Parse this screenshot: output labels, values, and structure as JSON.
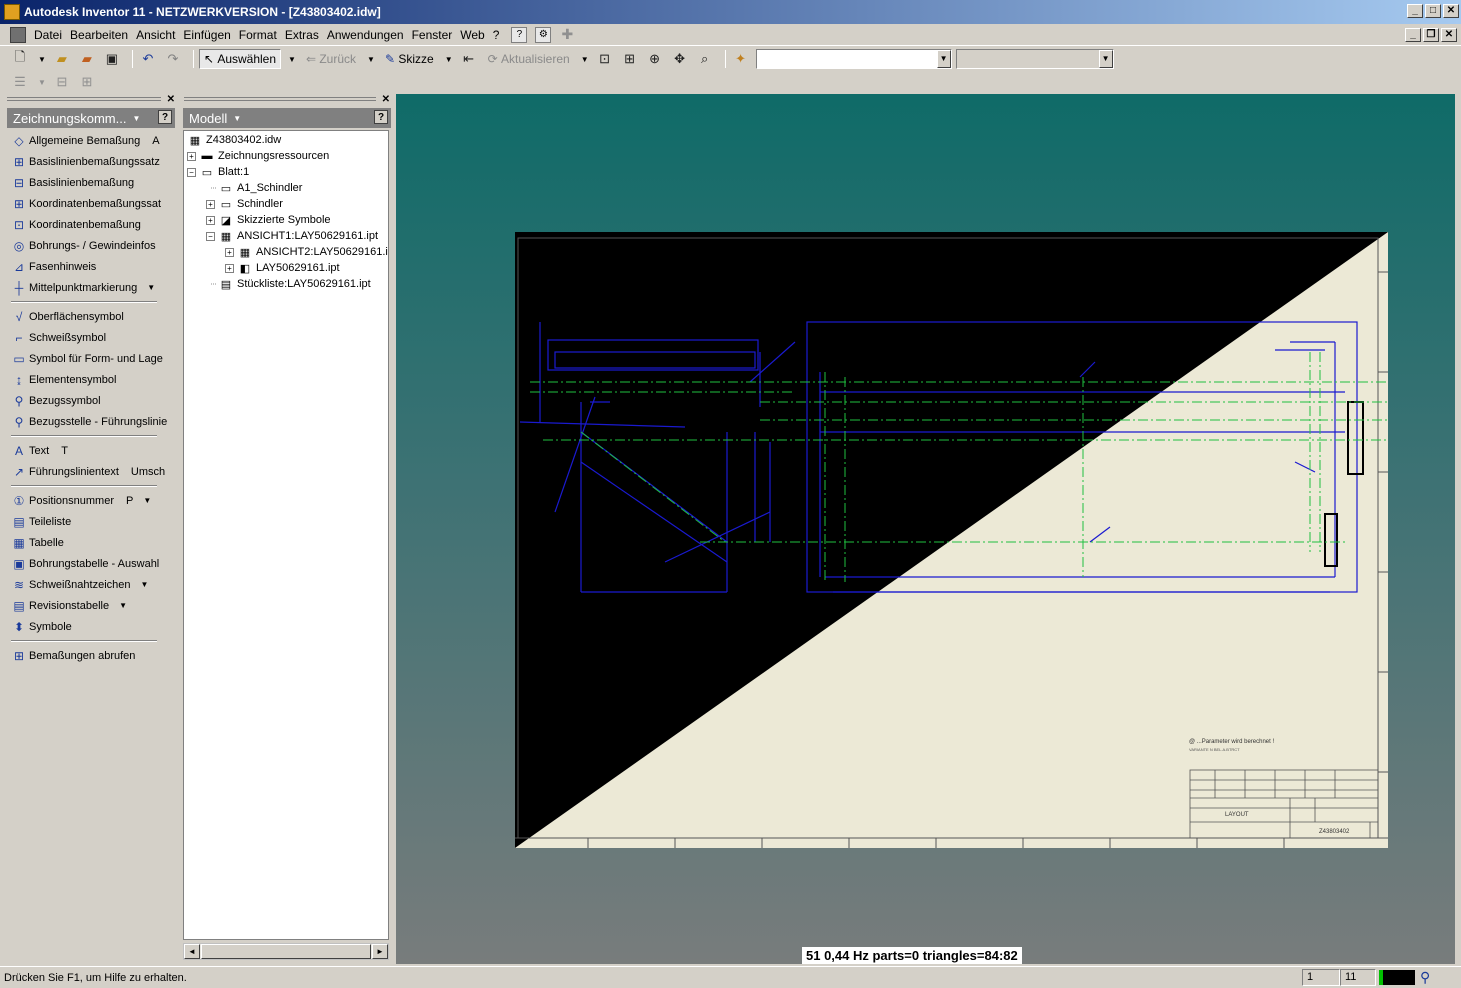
{
  "window": {
    "title": "Autodesk Inventor 11 - NETZWERKVERSION - [Z43803402.idw]",
    "buttons": [
      "_",
      "□",
      "✕"
    ]
  },
  "menubar": {
    "items": [
      "Datei",
      "Bearbeiten",
      "Ansicht",
      "Einfügen",
      "Format",
      "Extras",
      "Anwendungen",
      "Fenster",
      "Web",
      "?"
    ]
  },
  "toolbar": {
    "select_label": "Auswählen",
    "back_label": "Zurück",
    "sketch_label": "Skizze",
    "update_label": "Aktualisieren",
    "combo1_value": "",
    "combo2_value": ""
  },
  "commands_panel": {
    "title": "Zeichnungskomm...",
    "help": "?",
    "groups": [
      [
        {
          "icon": "general-dimension-icon",
          "glyph": "◇",
          "label": "Allgemeine Bemaßung",
          "shortcut": "A",
          "dropdown": ""
        },
        {
          "icon": "baseline-set-icon",
          "glyph": "⊞",
          "label": "Basislinienbemaßungssatz",
          "shortcut": "",
          "dropdown": ""
        },
        {
          "icon": "baseline-dimension-icon",
          "glyph": "⊟",
          "label": "Basislinienbemaßung",
          "shortcut": "",
          "dropdown": ""
        },
        {
          "icon": "ordinate-set-icon",
          "glyph": "⊞",
          "label": "Koordinatenbemaßungssat",
          "shortcut": "",
          "dropdown": ""
        },
        {
          "icon": "ordinate-dimension-icon",
          "glyph": "⊡",
          "label": "Koordinatenbemaßung",
          "shortcut": "",
          "dropdown": ""
        },
        {
          "icon": "hole-thread-note-icon",
          "glyph": "◎",
          "label": "Bohrungs- / Gewindeinfos",
          "shortcut": "",
          "dropdown": ""
        },
        {
          "icon": "chamfer-note-icon",
          "glyph": "⊿",
          "label": "Fasenhinweis",
          "shortcut": "",
          "dropdown": ""
        },
        {
          "icon": "center-mark-icon",
          "glyph": "┼",
          "label": "Mittelpunktmarkierung",
          "shortcut": "",
          "dropdown": "▼"
        }
      ],
      [
        {
          "icon": "surface-texture-icon",
          "glyph": "√",
          "label": "Oberflächensymbol",
          "shortcut": "",
          "dropdown": ""
        },
        {
          "icon": "weld-symbol-icon",
          "glyph": "⌐",
          "label": "Schweißsymbol",
          "shortcut": "",
          "dropdown": ""
        },
        {
          "icon": "feature-control-frame-icon",
          "glyph": "▭",
          "label": "Symbol für Form- und Lage",
          "shortcut": "",
          "dropdown": ""
        },
        {
          "icon": "feature-identifier-icon",
          "glyph": "↨",
          "label": "Elementensymbol",
          "shortcut": "",
          "dropdown": ""
        },
        {
          "icon": "datum-identifier-icon",
          "glyph": "⚲",
          "label": "Bezugssymbol",
          "shortcut": "",
          "dropdown": ""
        },
        {
          "icon": "datum-target-leader-icon",
          "glyph": "⚲",
          "label": "Bezugsstelle - Führungslinie",
          "shortcut": "",
          "dropdown": ""
        }
      ],
      [
        {
          "icon": "text-icon",
          "glyph": "A",
          "label": "Text",
          "shortcut": "T",
          "dropdown": ""
        },
        {
          "icon": "leader-text-icon",
          "glyph": "↗",
          "label": "Führungslinientext",
          "shortcut": "Umsch",
          "dropdown": ""
        }
      ],
      [
        {
          "icon": "balloon-icon",
          "glyph": "①",
          "label": "Positionsnummer",
          "shortcut": "P",
          "dropdown": "▼"
        },
        {
          "icon": "parts-list-icon",
          "glyph": "▤",
          "label": "Teileliste",
          "shortcut": "",
          "dropdown": ""
        },
        {
          "icon": "table-icon",
          "glyph": "▦",
          "label": "Tabelle",
          "shortcut": "",
          "dropdown": ""
        },
        {
          "icon": "hole-table-icon",
          "glyph": "▣",
          "label": "Bohrungstabelle - Auswahl",
          "shortcut": "",
          "dropdown": ""
        },
        {
          "icon": "weld-caterpillar-icon",
          "glyph": "≋",
          "label": "Schweißnahtzeichen",
          "shortcut": "",
          "dropdown": "▼"
        },
        {
          "icon": "revision-table-icon",
          "glyph": "▤",
          "label": "Revisionstabelle",
          "shortcut": "",
          "dropdown": "▼"
        },
        {
          "icon": "symbols-icon",
          "glyph": "⬍",
          "label": "Symbole",
          "shortcut": "",
          "dropdown": ""
        }
      ],
      [
        {
          "icon": "retrieve-dimensions-icon",
          "glyph": "⊞",
          "label": "Bemaßungen abrufen",
          "shortcut": "",
          "dropdown": ""
        }
      ]
    ]
  },
  "browser": {
    "title": "Modell",
    "help": "?",
    "nodes": [
      {
        "label": "Z43803402.idw",
        "level": 0,
        "expander": "",
        "icon": "drawing-file-icon",
        "glyph": "▦"
      },
      {
        "label": "Zeichnungsressourcen",
        "level": 0,
        "expander": "+",
        "icon": "folder-icon",
        "glyph": "▬"
      },
      {
        "label": "Blatt:1",
        "level": 0,
        "expander": "−",
        "icon": "sheet-icon",
        "glyph": "▭"
      },
      {
        "label": "A1_Schindler",
        "level": 1,
        "expander": "",
        "icon": "border-icon",
        "glyph": "▭"
      },
      {
        "label": "Schindler",
        "level": 1,
        "expander": "+",
        "icon": "title-block-icon",
        "glyph": "▭"
      },
      {
        "label": "Skizzierte Symbole",
        "level": 1,
        "expander": "+",
        "icon": "sketched-symbols-icon",
        "glyph": "◪"
      },
      {
        "label": "ANSICHT1:LAY50629161.ipt",
        "level": 1,
        "expander": "−",
        "icon": "view-icon",
        "glyph": "▦"
      },
      {
        "label": "ANSICHT2:LAY50629161.i",
        "level": 2,
        "expander": "+",
        "icon": "view-icon",
        "glyph": "▦"
      },
      {
        "label": "LAY50629161.ipt",
        "level": 2,
        "expander": "+",
        "icon": "part-icon",
        "glyph": "◧"
      },
      {
        "label": "Stückliste:LAY50629161.ipt",
        "level": 1,
        "expander": "",
        "icon": "parts-list-icon",
        "glyph": "▤"
      }
    ]
  },
  "graphics": {
    "fps_readout": "51   0,44 Hz  parts=0 triangles=84:82",
    "sheet_note_1": "@ ...Parameter wird berechnet !",
    "sheet_note_2": "VARIANTE N BEL.A.BTRCT",
    "title_block_name": "LAYOUT",
    "title_block_number": "Z43803402",
    "colors": {
      "sheet_paper": "#ece9d6",
      "sheet_dark": "#000000",
      "geometry": "#1a1ad0",
      "centerline": "#20c040"
    }
  },
  "statusbar": {
    "help_text": "Drücken Sie F1, um Hilfe zu erhalten.",
    "field1": "1",
    "field2": "11"
  }
}
